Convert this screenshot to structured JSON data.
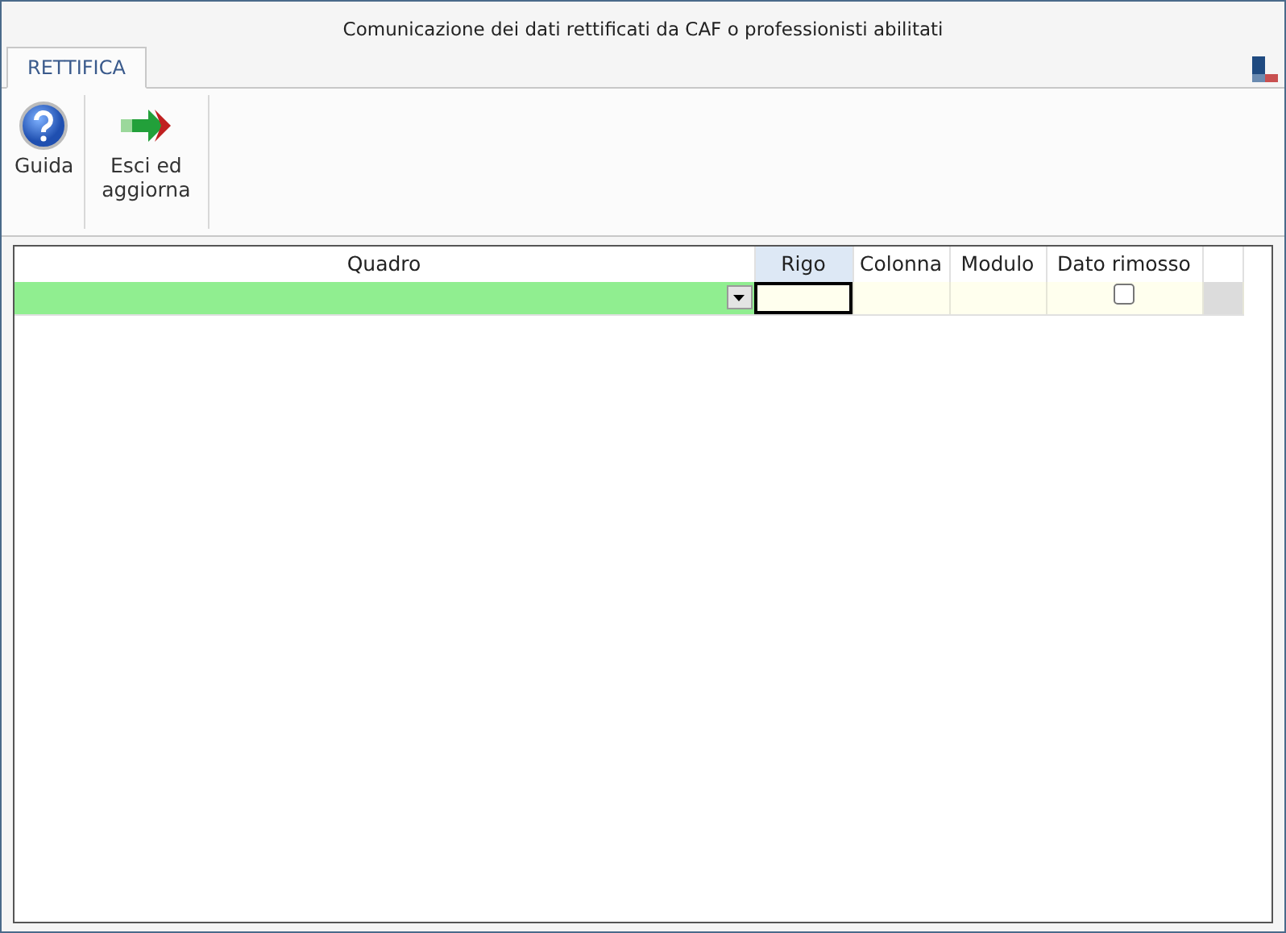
{
  "window": {
    "title": "Comunicazione dei dati rettificati da CAF o professionisti abilitati"
  },
  "tabs": [
    {
      "label": "RETTIFICA",
      "selected": true
    }
  ],
  "ribbon": {
    "buttons": [
      {
        "label": "Guida",
        "kind": "help"
      },
      {
        "label": "Esci ed aggiorna",
        "kind": "exit"
      }
    ]
  },
  "table": {
    "columns": [
      {
        "label": "Quadro",
        "selected": false
      },
      {
        "label": "Rigo",
        "selected": true
      },
      {
        "label": "Colonna",
        "selected": false
      },
      {
        "label": "Modulo",
        "selected": false
      },
      {
        "label": "Dato rimosso",
        "selected": false
      }
    ],
    "rows": [
      {
        "dato_rimosso": false
      }
    ]
  }
}
